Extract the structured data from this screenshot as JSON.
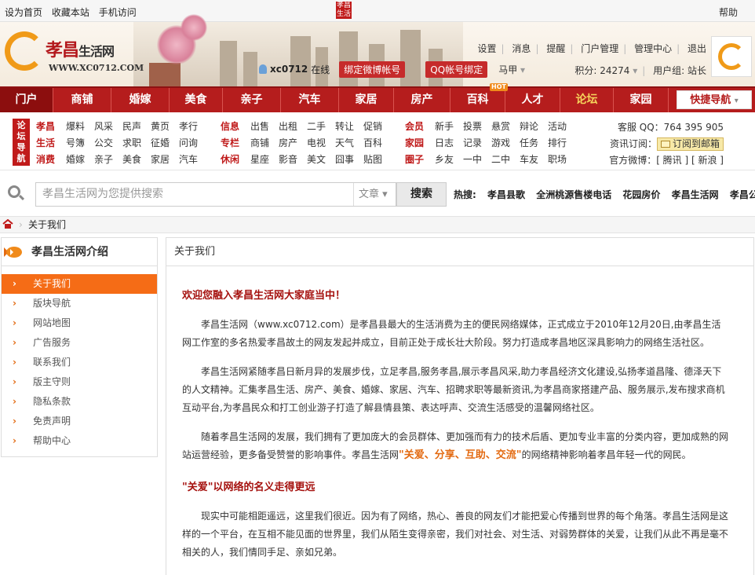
{
  "topbar": {
    "set_home": "设为首页",
    "bookmark": "收藏本站",
    "mobile": "手机访问",
    "help": "帮助",
    "stamp": "孝昌生活"
  },
  "header": {
    "logo_name": "孝昌",
    "logo_name2": "生活网",
    "logo_url": "WWW.XC0712.COM",
    "username": "xc0712",
    "online": "在线",
    "bind_weibo": "绑定微博帐号",
    "bind_qq": "QQ帐号绑定",
    "mahao": "马甲",
    "links": [
      "设置",
      "消息",
      "提醒",
      "门户管理",
      "管理中心",
      "退出"
    ],
    "points_label": "积分: 24274",
    "usergroup_label": "用户组: 站长"
  },
  "nav": {
    "items": [
      "门户",
      "商铺",
      "婚嫁",
      "美食",
      "亲子",
      "汽车",
      "家居",
      "房产",
      "百科",
      "人才",
      "论坛",
      "家园"
    ],
    "hot_badge": "HOT",
    "quick_nav": "快捷导航"
  },
  "subnav": {
    "forum_tag": "论坛导航",
    "col1": [
      [
        "孝昌",
        "爆料",
        "风采",
        "民声",
        "黄页",
        "孝行"
      ],
      [
        "生活",
        "号簿",
        "公交",
        "求职",
        "征婚",
        "问询"
      ],
      [
        "消费",
        "婚嫁",
        "亲子",
        "美食",
        "家居",
        "汽车"
      ]
    ],
    "col2": [
      [
        "信息",
        "出售",
        "出租",
        "二手",
        "转让",
        "促销"
      ],
      [
        "专栏",
        "商铺",
        "房产",
        "电视",
        "天气",
        "百科"
      ],
      [
        "休闲",
        "星座",
        "影音",
        "美文",
        "囧事",
        "贴图"
      ]
    ],
    "col3": [
      [
        "会员",
        "新手",
        "投票",
        "悬赏",
        "辩论",
        "活动"
      ],
      [
        "家园",
        "日志",
        "记录",
        "游戏",
        "任务",
        "排行"
      ],
      [
        "圈子",
        "乡友",
        "一中",
        "二中",
        "车友",
        "职场"
      ]
    ],
    "service_qq": "客服 QQ：764 395 905",
    "subscribe_label": "资讯订阅：",
    "subscribe_btn": "订阅到邮箱",
    "weibo_label": "官方微博：[ 腾讯 ] [ 新浪 ]"
  },
  "search": {
    "placeholder": "孝昌生活网为您提供搜索",
    "type": "文章",
    "button": "搜索",
    "hot_label": "热搜:",
    "hot_words": [
      "孝昌县歌",
      "全洲桃源售楼电话",
      "花园房价",
      "孝昌生活网",
      "孝昌公交"
    ]
  },
  "breadcrumb": {
    "sep": "›",
    "current": "关于我们"
  },
  "sidebar": {
    "title": "孝昌生活网介绍",
    "items": [
      "关于我们",
      "版块导航",
      "网站地图",
      "广告服务",
      "联系我们",
      "版主守则",
      "隐私条款",
      "免责声明",
      "帮助中心"
    ]
  },
  "main": {
    "title": "关于我们",
    "heading1": "欢迎您融入孝昌生活网大家庭当中！",
    "p1": "孝昌生活网（www.xc0712.com）是孝昌县最大的生活消费为主的便民网络媒体，正式成立于2010年12月20日,由孝昌生活网工作室的多名热爱孝昌故土的网友发起并成立，目前正处于成长壮大阶段。努力打造成孝昌地区深具影响力的网络生活社区。",
    "p2": "孝昌生活网紧随孝昌日新月异的发展步伐，立足孝昌,服务孝昌,展示孝昌风采,助力孝昌经济文化建设,弘扬孝道昌隆、德泽天下的人文精神。汇集孝昌生活、房产、美食、婚嫁、家居、汽车、招聘求职等最新资讯,为孝昌商家搭建产品、服务展示,发布搜求商机互动平台,为孝昌民众和打工创业游子打造了解县情县策、表达呼声、交流生活感受的温馨网络社区。",
    "p3_before": "随着孝昌生活网的发展，我们拥有了更加庞大的会员群体、更加强而有力的技术后盾、更加专业丰富的分类内容，更加成熟的网站运营经验，更多备受赞誉的影响事件。孝昌生活网",
    "p3_em": "\"关爱、分享、互助、交流\"",
    "p3_after": "的网络精神影响着孝昌年轻一代的网民。",
    "heading2": "\"关爱\"以网络的名义走得更远",
    "p4": "现实中可能相距遥远，这里我们很近。因为有了网络，热心、善良的网友们才能把爱心传播到世界的每个角落。孝昌生活网是这样的一个平台，在互相不能见面的世界里，我们从陌生变得亲密，我们对社会、对生活、对弱势群体的关爱，让我们从此不再是毫不相关的人，我们情同手足、亲如兄弟。"
  },
  "colors": {
    "nav_red": "#b51d1d",
    "accent_orange": "#f56c16",
    "heading_red": "#a5110e"
  }
}
